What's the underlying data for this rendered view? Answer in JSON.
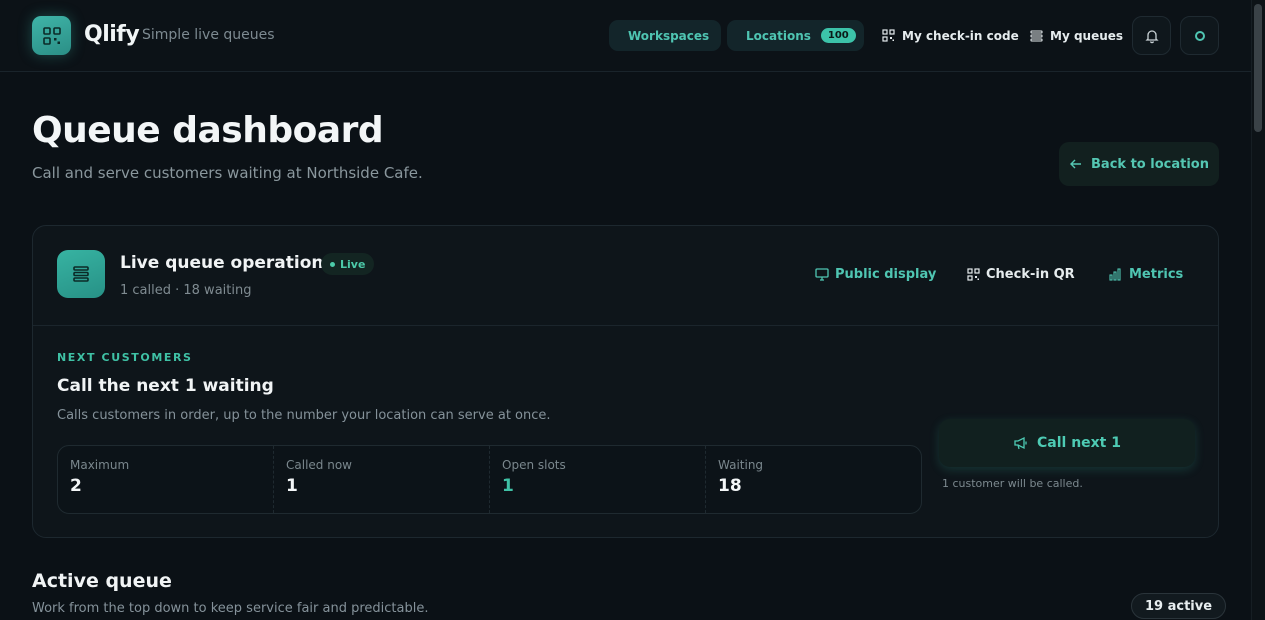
{
  "header": {
    "brand": "Qlify",
    "tagline": "Simple live queues",
    "nav": {
      "workspaces": "Workspaces",
      "locations": "Locations",
      "locations_count": "100",
      "checkin_code": "My check-in code",
      "my_queues": "My queues"
    },
    "icons": [
      "qr-code-icon",
      "building-icon",
      "map-pin-icon",
      "list-icon",
      "bell-icon",
      "user-icon"
    ]
  },
  "page": {
    "title": "Queue dashboard",
    "subtitle": "Call and serve customers waiting at Northside Cafe.",
    "back_label": "Back to location"
  },
  "card": {
    "title": "Live queue operations",
    "status": "Live",
    "meta": "1 called · 18 waiting",
    "actions": {
      "public_display": "Public display",
      "checkin_qr": "Check-in QR",
      "metrics": "Metrics"
    },
    "eyebrow": "NEXT CUSTOMERS",
    "section_title": "Call the next 1 waiting",
    "section_desc": "Calls customers in order, up to the number your location can serve at once.",
    "stats": [
      {
        "label": "Maximum",
        "value": "2"
      },
      {
        "label": "Called now",
        "value": "1"
      },
      {
        "label": "Open slots",
        "value": "1"
      },
      {
        "label": "Waiting",
        "value": "18"
      }
    ],
    "call_button": "Call next 1",
    "call_note": "1 customer will be called."
  },
  "active_queue": {
    "title": "Active queue",
    "desc": "Work from the top down to keep service fair and predictable.",
    "badge": "19 active"
  },
  "colors": {
    "accent": "#3fc1a5",
    "background": "#0b1116",
    "card": "#0e151a"
  }
}
